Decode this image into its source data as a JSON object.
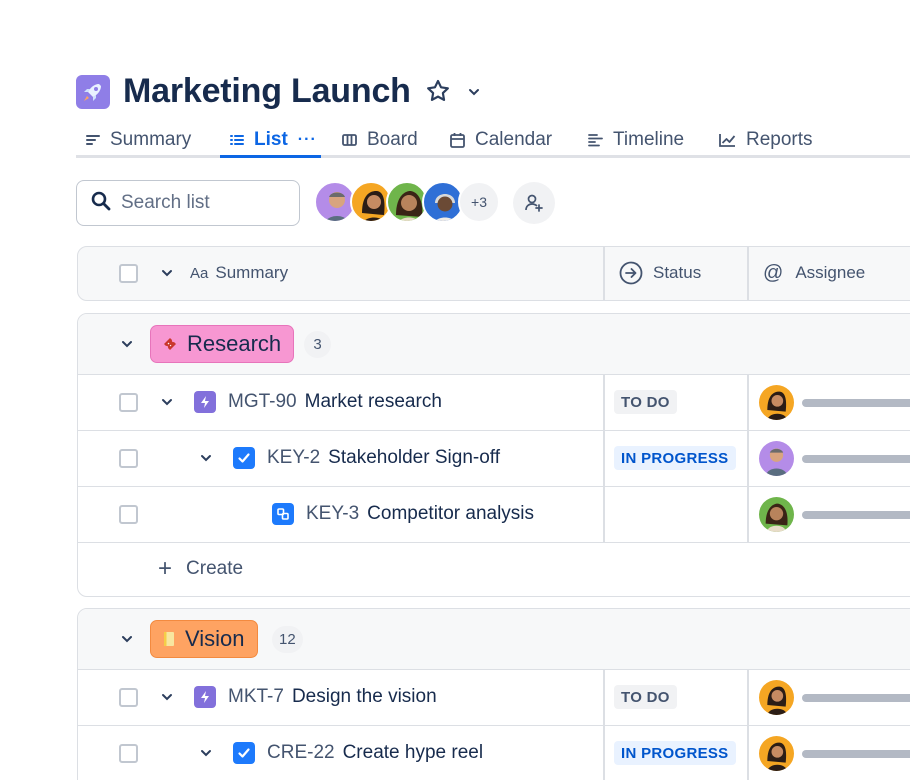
{
  "project": {
    "title": "Marketing Launch",
    "icon": "rocket-icon"
  },
  "tabs": [
    {
      "label": "Summary",
      "icon": "summary-icon"
    },
    {
      "label": "List",
      "icon": "list-icon",
      "active": true
    },
    {
      "label": "Board",
      "icon": "board-icon"
    },
    {
      "label": "Calendar",
      "icon": "calendar-icon"
    },
    {
      "label": "Timeline",
      "icon": "timeline-icon"
    },
    {
      "label": "Reports",
      "icon": "reports-icon"
    }
  ],
  "search": {
    "placeholder": "Search list"
  },
  "people": {
    "more_label": "+3"
  },
  "columns": {
    "summary": "Summary",
    "status": "Status",
    "assignee": "Assignee"
  },
  "groups": [
    {
      "name": "Research",
      "count": "3",
      "color": "#f797d2",
      "rows": [
        {
          "key": "MGT-90",
          "summary": "Market research",
          "status": "TO DO",
          "type": "epic"
        },
        {
          "key": "KEY-2",
          "summary": "Stakeholder Sign-off",
          "status": "IN PROGRESS",
          "type": "task"
        },
        {
          "key": "KEY-3",
          "summary": "Competitor analysis",
          "status": "",
          "type": "subtask"
        }
      ],
      "create_label": "Create"
    },
    {
      "name": "Vision",
      "count": "12",
      "color": "#fea362",
      "rows": [
        {
          "key": "MKT-7",
          "summary": "Design the vision",
          "status": "TO DO",
          "type": "epic"
        },
        {
          "key": "CRE-22",
          "summary": "Create hype reel",
          "status": "IN PROGRESS",
          "type": "task"
        }
      ]
    }
  ],
  "colors": {
    "accent": "#0c66e4",
    "epic": "#8270db",
    "task": "#1d7afc"
  }
}
